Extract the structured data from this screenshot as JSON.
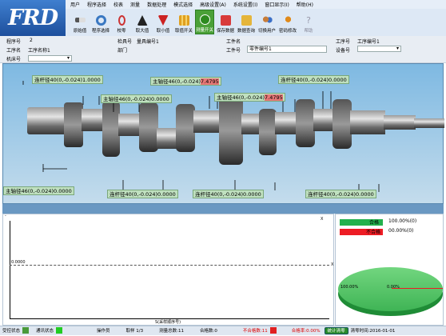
{
  "logo": "FRD",
  "menu": [
    "用户",
    "程序选择",
    "校表",
    "测量",
    "数据处理",
    "模式选择",
    "高级设置(A)",
    "系统设置(I)",
    "窗口显示(I)",
    "帮助(H)"
  ],
  "toolbar": [
    {
      "label": "原始值",
      "icon": "caliper-icon"
    },
    {
      "label": "程序选择",
      "icon": "refresh-icon"
    },
    {
      "label": "校零",
      "icon": "zero-icon"
    },
    {
      "label": "取大值",
      "icon": "max-icon"
    },
    {
      "label": "取小值",
      "icon": "min-icon"
    },
    {
      "label": "取值开关",
      "icon": "grid-icon"
    },
    {
      "label": "测量开关",
      "icon": "measure-icon"
    },
    {
      "label": "保存数据",
      "icon": "save-icon"
    },
    {
      "label": "数据查询",
      "icon": "query-icon"
    },
    {
      "label": "切换用户",
      "icon": "users-icon"
    },
    {
      "label": "密码修改",
      "icon": "key-icon"
    },
    {
      "label": "帮助",
      "icon": "help-icon"
    }
  ],
  "info": {
    "program_no_label": "程序号",
    "program_no": "2",
    "work_no_label": "工序名",
    "work_name_label": "工序名称1",
    "machine_label": "机床号",
    "gauge_label": "检具号",
    "gauge_value": "量具编号1",
    "dept_label": "部门",
    "part_name_label": "工件名",
    "part_no_label": "工件号",
    "part_no_value": "零件编号1",
    "proc_no_label": "工序号",
    "proc_no_value": "工序编号1",
    "equip_label": "设备号"
  },
  "tags": [
    {
      "label": "连杆径40(0,-0.024)",
      "value": "1.0000",
      "bad": false
    },
    {
      "label": "主轴径46(0,-0.024)",
      "value": "7.4795",
      "bad": true
    },
    {
      "label": "连杆径40(0,-0.024)",
      "value": "0.0000",
      "bad": false
    },
    {
      "label": "主轴径46(0,-0.024)",
      "value": "0.0000",
      "bad": false
    },
    {
      "label": "主轴径46(0,-0.024)",
      "value": "7.4795",
      "bad": true
    },
    {
      "label": "主轴径46(0,-0.024)",
      "value": "0.0000",
      "bad": false
    },
    {
      "label": "连杆径40(0,-0.024)",
      "value": "0.0000",
      "bad": false
    },
    {
      "label": "连杆径40(0,-0.024)",
      "value": "0.0000",
      "bad": false
    },
    {
      "label": "连杆径40(0,-0.024)",
      "value": "0.0000",
      "bad": false
    }
  ],
  "chart": {
    "y_label": "0.0000",
    "x_caption": "S(采样顺序号)",
    "x_mark": "X",
    "x_end": "X"
  },
  "legend": {
    "pass_label": "合格",
    "pass_value": "100.00%(0)",
    "pass_color": "#22b14c",
    "fail_label": "不合格",
    "fail_value": "00.00%(0)",
    "fail_color": "#ed1c24",
    "pie_left": "100.00%",
    "pie_right": "0.00%"
  },
  "status": {
    "ctrl": "受控状态",
    "comm": "通讯状态",
    "operator": "操作员",
    "sample": "取样 1/3",
    "total": "测量总数:11",
    "pass": "合格数:0",
    "fail": "不合格数:11",
    "rate": "合格率:0.00%",
    "clear": "统计清零",
    "clear_time": "清零时间:2016-01-01"
  }
}
